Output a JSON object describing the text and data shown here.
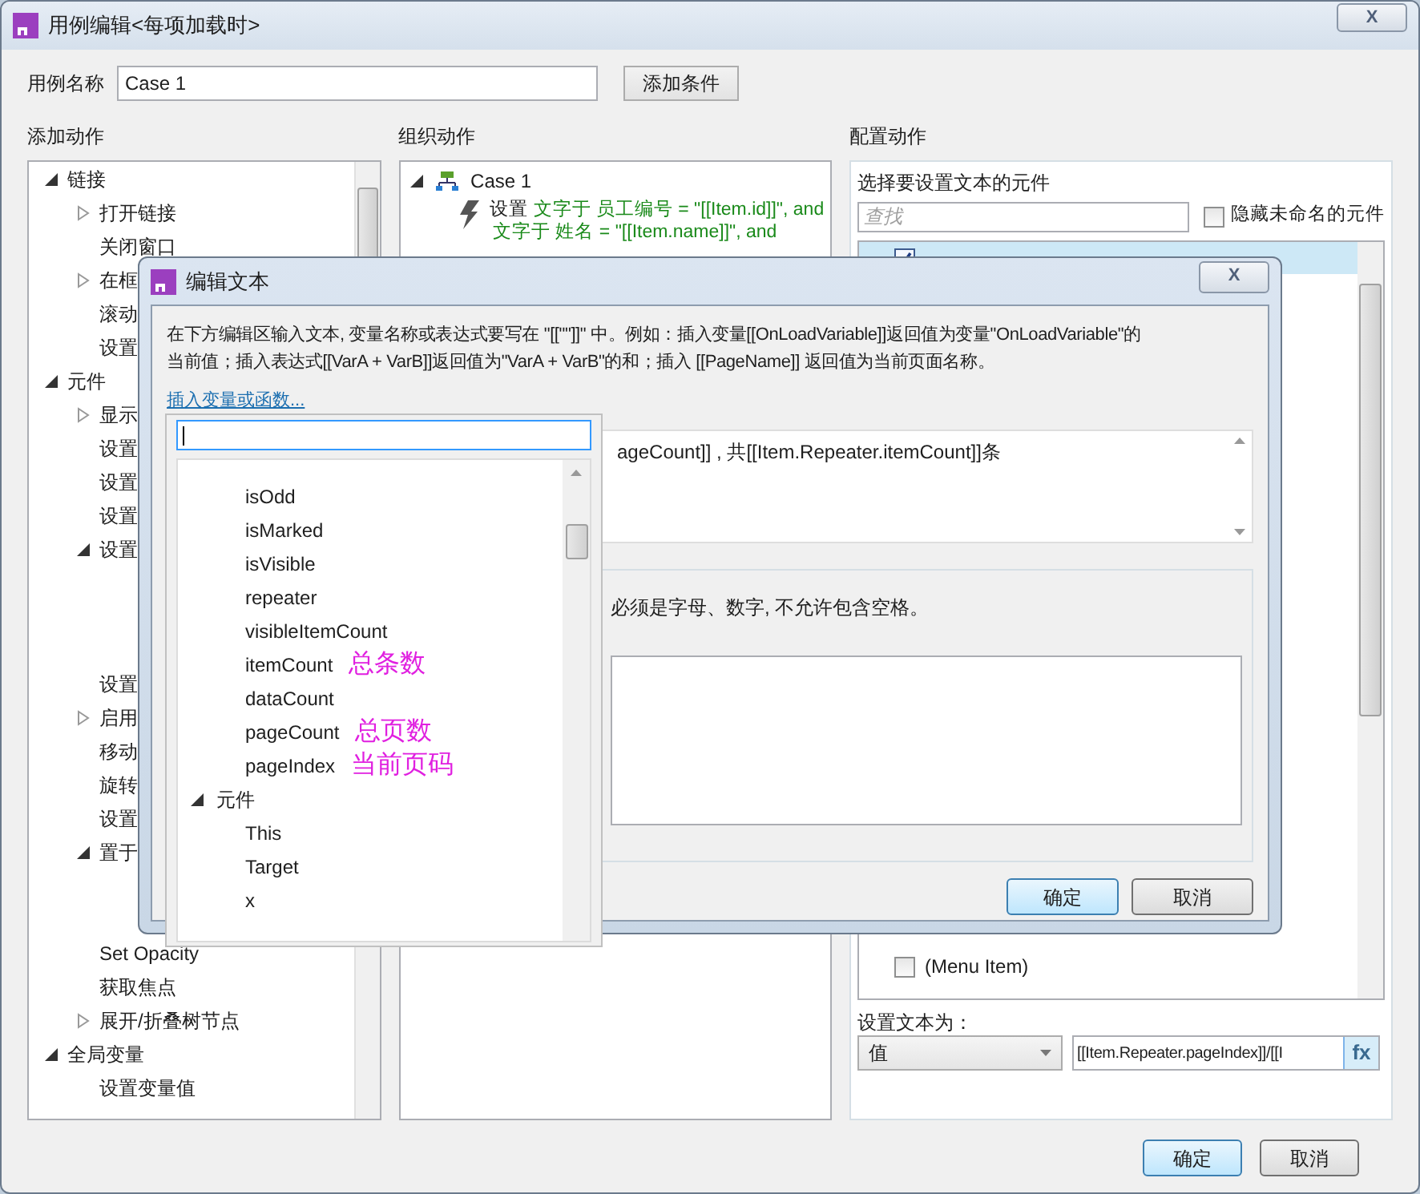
{
  "window": {
    "title": "用例编辑<每项加载时>",
    "close": "X"
  },
  "case_name": {
    "label": "用例名称",
    "value": "Case 1",
    "add_condition": "添加条件"
  },
  "add_actions": {
    "heading": "添加动作",
    "tree": [
      {
        "label": "链接",
        "expanded": true,
        "children": [
          {
            "label": "打开链接",
            "expanded": false
          },
          {
            "label": "关闭窗口"
          },
          {
            "label": "在框",
            "expanded": false
          },
          {
            "label": "滚动"
          },
          {
            "label": "设置"
          }
        ]
      },
      {
        "label": "元件",
        "expanded": true,
        "children": [
          {
            "label": "显示",
            "expanded": false
          },
          {
            "label": "设置"
          },
          {
            "label": "设置"
          },
          {
            "label": "设置"
          },
          {
            "label": "设置",
            "expanded": true,
            "children": [
              {
                "kind": "covered"
              },
              {
                "kind": "covered"
              },
              {
                "kind": "covered"
              }
            ]
          },
          {
            "label": "设置"
          },
          {
            "label": "启用",
            "expanded": false
          },
          {
            "label": "移动"
          },
          {
            "label": "旋转"
          },
          {
            "label": "设置"
          },
          {
            "label": "置于",
            "expanded": true,
            "children": [
              {
                "kind": "covered"
              },
              {
                "kind": "covered"
              }
            ]
          },
          {
            "label": "Set Opacity"
          },
          {
            "label": "获取焦点"
          },
          {
            "label": "展开/折叠树节点",
            "expanded": false
          }
        ]
      },
      {
        "label": "全局变量",
        "expanded": true,
        "children": [
          {
            "label": "设置变量值"
          }
        ]
      }
    ]
  },
  "organize_actions": {
    "heading": "组织动作",
    "case": {
      "label": "Case 1",
      "expanded": true,
      "action": {
        "verb": "设置",
        "lines": [
          "文字于 员工编号 = \"[[Item.id]]\", and",
          "文字于 姓名 = \"[[Item.name]]\", and"
        ]
      }
    }
  },
  "configure_actions": {
    "heading": "配置动作",
    "prompt": "选择要设置文本的元件",
    "search": {
      "placeholder": "查找"
    },
    "hide_unnamed": {
      "label": "隐藏未命名的元件",
      "checked": false
    },
    "widgets": [
      {
        "checked": true,
        "selected": true
      },
      {
        "label": "(Menu Item)",
        "checked": false,
        "selected": false
      }
    ],
    "set_text_label": "设置文本为：",
    "type": "值",
    "value": "[[Item.Repeater.pageIndex]]/[[I",
    "fx": "fx"
  },
  "buttons": [
    "确定",
    "取消"
  ],
  "edit_text_dialog": {
    "title": "编辑文本",
    "close": "X",
    "description_lines": [
      "在下方编辑区输入文本, 变量名称或表达式要写在 \"[[\"\"]]\" 中。例如：插入变量[[OnLoadVariable]]返回值为变量\"OnLoadVariable\"的",
      "当前值；插入表达式[[VarA + VarB]]返回值为\"VarA + VarB\"的和；插入 [[PageName]] 返回值为当前页面名称。"
    ],
    "insert_link": "插入变量或函数...",
    "text": "ageCount]] , 共[[Item.Repeater.itemCount]]条",
    "local_note": "必须是字母、数字, 不允许包含空格。",
    "buttons": [
      "确定",
      "取消"
    ]
  },
  "insert_popup": {
    "items": [
      {
        "label": "isOdd"
      },
      {
        "label": "isMarked"
      },
      {
        "label": "isVisible"
      },
      {
        "label": "repeater"
      },
      {
        "label": "visibleItemCount"
      },
      {
        "label": "itemCount",
        "note": "总条数"
      },
      {
        "label": "dataCount"
      },
      {
        "label": "pageCount",
        "note": "总页数"
      },
      {
        "label": "pageIndex",
        "note": "当前页码"
      },
      {
        "label": "元件",
        "expanded": true,
        "children": [
          {
            "label": "This"
          },
          {
            "label": "Target"
          },
          {
            "label": "x"
          }
        ]
      }
    ]
  }
}
